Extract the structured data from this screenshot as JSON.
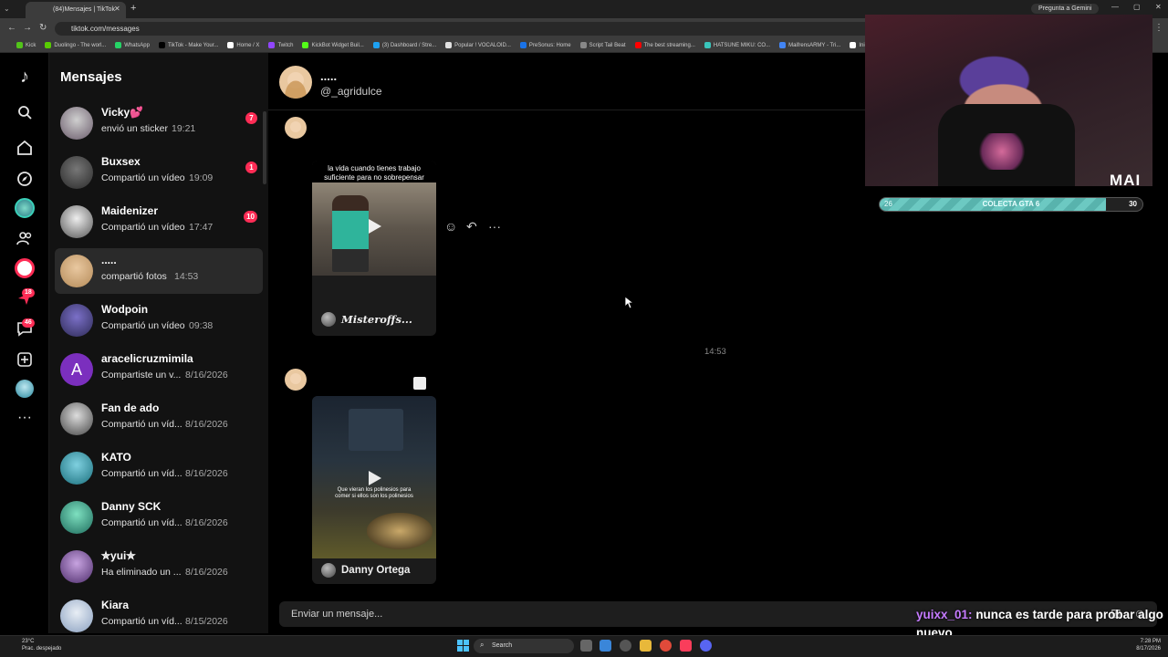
{
  "browser": {
    "tab_title": "(84)Mensajes | TikTok",
    "url": "tiktok.com/messages",
    "gemini_label": "Pregunta a Gemini",
    "bookmarks": [
      "Kick",
      "Duolingo - The worl...",
      "WhatsApp",
      "TikTok - Make Your...",
      "Home / X",
      "Twitch",
      "KickBot Widget Buil...",
      "(3) Dashboard / Stre...",
      "Popular ! VOCALOID...",
      "PreSonus: Home",
      "Script Tail Beat",
      "The best streaming...",
      "HATSUNE MIKU: CO...",
      "MaifrensARMY - Tri...",
      "Inicio"
    ]
  },
  "rail": {
    "badges": {
      "activity": "18",
      "messages": "46"
    }
  },
  "sidebar": {
    "title": "Mensajes",
    "conversations": [
      {
        "name": "Vicky💕",
        "preview": "envió un sticker",
        "time": "19:21",
        "badge": "7"
      },
      {
        "name": "Buxsex",
        "preview": "Compartió un vídeo",
        "time": "19:09",
        "badge": "1"
      },
      {
        "name": "Maidenizer",
        "preview": "Compartió un vídeo",
        "time": "17:47",
        "badge": "10"
      },
      {
        "name": ".....",
        "preview": "compartió fotos",
        "time": "14:53",
        "badge": ""
      },
      {
        "name": "Wodpoin",
        "preview": "Compartió un vídeo",
        "time": "09:38",
        "badge": ""
      },
      {
        "name": "aracelicruzmimila",
        "preview": "Compartiste un v...",
        "time": "8/16/2026",
        "badge": "",
        "initial": "A"
      },
      {
        "name": "Fan de ado",
        "preview": "Compartió un víd...",
        "time": "8/16/2026",
        "badge": ""
      },
      {
        "name": "KATO",
        "preview": "Compartió un víd...",
        "time": "8/16/2026",
        "badge": ""
      },
      {
        "name": "Danny SCK",
        "preview": "Compartió un víd...",
        "time": "8/16/2026",
        "badge": ""
      },
      {
        "name": "✮yui✮",
        "preview": "Ha eliminado un ...",
        "time": "8/16/2026",
        "badge": ""
      },
      {
        "name": "Kiara",
        "preview": "Compartió un víd...",
        "time": "8/15/2026",
        "badge": ""
      }
    ]
  },
  "chat": {
    "name": ".....",
    "username": "@_agridulce",
    "messages": [
      {
        "caption": "la vida cuando tienes trabajo suficiente para no sobrepensar",
        "author": "Misteroffs..."
      },
      {
        "caption": "Que vieran los polinesios para comer si ellos son los polinesios",
        "author": "Danny Ortega"
      }
    ],
    "timestamp": "14:53",
    "composer_placeholder": "Enviar un mensaje..."
  },
  "stream_overlay": {
    "brand": "MAI",
    "goal_label": "COLECTA GTA 6",
    "goal_current": "26",
    "goal_target": "30",
    "goal_progress": 0.86,
    "chat_user": "yuixx_01:",
    "chat_text": "nunca es tarde para probar algo nuevo"
  },
  "taskbar": {
    "weather_temp": "23°C",
    "weather_desc": "Prac. despejado",
    "search_label": "Search",
    "time": "7:28 PM",
    "date": "8/17/2026"
  }
}
